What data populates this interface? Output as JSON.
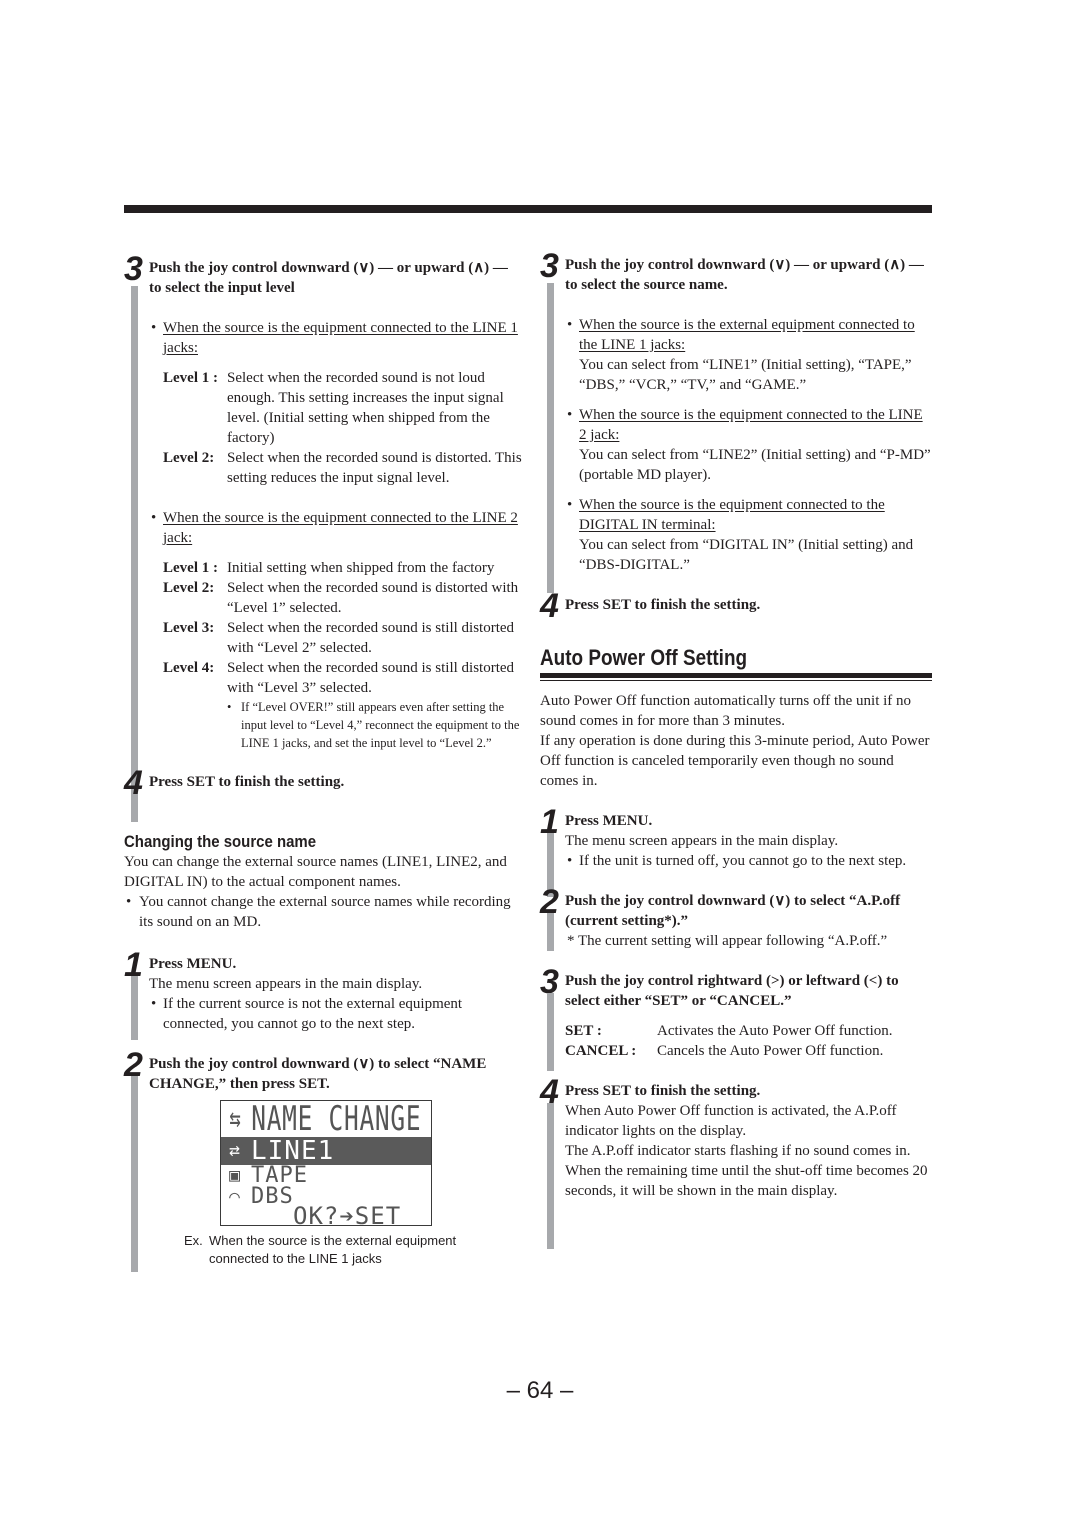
{
  "page_number": "– 64 –",
  "left_column": {
    "step3": {
      "number": "3",
      "title": "Push the joy control downward (∨) — or upward (∧) — to select the input level",
      "line1": {
        "condition": "When the source is the equipment connected to the LINE 1 jacks:",
        "levels": [
          {
            "key": "Level 1 :",
            "text": "Select when the recorded sound is not loud enough. This setting increases the input signal level. (Initial setting when shipped from the factory)"
          },
          {
            "key": "Level 2:",
            "text": "Select when the recorded sound is distorted. This setting reduces the input signal level."
          }
        ]
      },
      "line2": {
        "condition": "When the source is the equipment connected to the LINE 2 jack:",
        "levels": [
          {
            "key": "Level 1 :",
            "text": "Initial setting when shipped from the factory"
          },
          {
            "key": "Level 2:",
            "text": "Select when the recorded sound is distorted with “Level 1” selected."
          },
          {
            "key": "Level 3:",
            "text": "Select when the recorded sound is still distorted with “Level 2” selected."
          },
          {
            "key": "Level 4:",
            "text": "Select when the recorded sound is still distorted with “Level 3” selected."
          }
        ],
        "note": "If “Level OVER!” still appears even after setting the input level to “Level 4,” reconnect the equipment to the LINE 1 jacks, and set the input level to “Level 2.”"
      }
    },
    "step4": {
      "number": "4",
      "title": "Press SET to finish the setting."
    },
    "changing_source": {
      "heading": "Changing the source name",
      "intro": "You can change the external source names (LINE1, LINE2, and DIGITAL IN) to the actual component names.",
      "bullet": "You cannot change the external source names while recording its sound on an MD.",
      "step1": {
        "number": "1",
        "title": "Press MENU.",
        "text": "The menu screen appears in the main display.",
        "bullet": "If the current source is not the external equipment connected, you cannot go to the next step."
      },
      "step2": {
        "number": "2",
        "title": "Push the joy control downward (∨) to select “NAME CHANGE,” then press SET.",
        "lcd": {
          "title": "NAME CHANGE",
          "rows": [
            {
              "icon": "line-input-icon",
              "glyph": "⇄",
              "label": "LINE1",
              "selected": true
            },
            {
              "icon": "tape-icon",
              "glyph": "▣",
              "label": "TAPE",
              "selected": false
            },
            {
              "icon": "satellite-dish-icon",
              "glyph": "⌒",
              "label": "DBS",
              "selected": false
            }
          ],
          "prompt": "OK?➔SET"
        },
        "caption_ex": "Ex.",
        "caption_line1": "When the source is the external equipment",
        "caption_line2": "connected to the LINE 1 jacks"
      }
    }
  },
  "right_column": {
    "step3": {
      "number": "3",
      "title": "Push the joy control downward (∨) — or upward (∧) — to select the source name.",
      "items": [
        {
          "condition": "When the source is the external equipment connected to the LINE 1 jacks:",
          "text": "You can select from “LINE1” (Initial setting), “TAPE,” “DBS,” “VCR,” “TV,” and “GAME.”"
        },
        {
          "condition": "When the source is the equipment connected to the LINE 2 jack:",
          "text": "You can select from “LINE2” (Initial setting) and “P-MD” (portable MD player)."
        },
        {
          "condition": "When the source is the equipment connected to the DIGITAL IN terminal:",
          "text": "You can select from “DIGITAL IN” (Initial setting) and “DBS-DIGITAL.”"
        }
      ]
    },
    "step4": {
      "number": "4",
      "title": "Press SET to finish the setting."
    },
    "auto_power_off": {
      "heading": "Auto Power Off Setting",
      "intro1": "Auto Power Off function automatically turns off the unit if no sound comes in for more than 3 minutes.",
      "intro2": "If any operation is done during this 3-minute period, Auto Power Off function is canceled temporarily even though no sound comes in.",
      "step1": {
        "number": "1",
        "title": "Press MENU.",
        "text": "The menu screen appears in the main display.",
        "bullet": "If the unit is turned off, you cannot go to the next step."
      },
      "step2": {
        "number": "2",
        "title": "Push the joy control downward (∨) to select “A.P.off (current setting*).”",
        "note": "* The current setting will appear following “A.P.off.”"
      },
      "step3": {
        "number": "3",
        "title": "Push the joy control rightward (>) or leftward (<) to select either “SET” or “CANCEL.”",
        "options": [
          {
            "key": "SET :",
            "text": "Activates the Auto Power Off function."
          },
          {
            "key": "CANCEL :",
            "text": "Cancels the Auto Power Off function."
          }
        ]
      },
      "step4": {
        "number": "4",
        "title": "Press SET to finish the setting.",
        "paragraphs": [
          "When Auto Power Off function is activated, the A.P.off indicator lights on the display.",
          "The A.P.off  indicator starts flashing if no sound comes in.",
          "When the remaining time until the shut-off time becomes 20 seconds, it will be shown in the main display."
        ]
      }
    }
  }
}
